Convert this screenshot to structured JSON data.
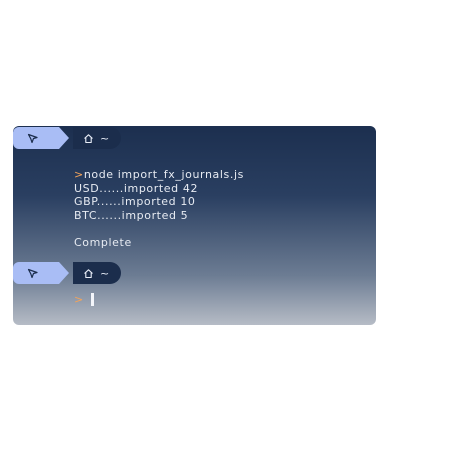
{
  "terminal": {
    "prompt": {
      "os_icon": "bird-logo-icon",
      "home_icon": "home-icon",
      "dir": "~"
    },
    "output": {
      "command_symbol": ">",
      "command": "node import_fx_journals.js",
      "lines": [
        "USD......imported 42",
        "GBP......imported 10",
        "BTC......imported 5"
      ],
      "status": "Complete"
    },
    "input": {
      "symbol": ">",
      "value": ""
    },
    "colors": {
      "os_segment": "#a9bdf5",
      "dir_segment": "#1b2d4c",
      "prompt_symbol": "#f3a35a",
      "text": "#e7ebf2"
    }
  }
}
